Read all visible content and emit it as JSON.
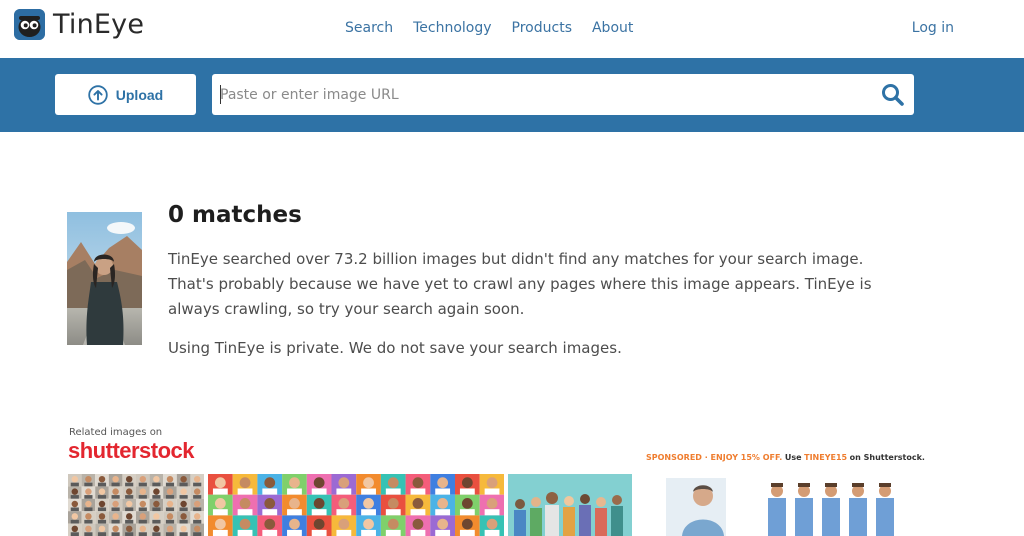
{
  "header": {
    "brand": "TinEye",
    "logo_icon": "tineye-logo-icon",
    "nav": [
      "Search",
      "Technology",
      "Products",
      "About"
    ],
    "login": "Log in"
  },
  "search": {
    "upload_label": "Upload",
    "upload_icon": "upload-arrow-icon",
    "placeholder": "Paste or enter image URL",
    "value": "",
    "search_icon": "magnifier-icon"
  },
  "result": {
    "title": "0 matches",
    "paragraph": "TinEye searched over 73.2 billion images but didn't find any matches for your search image. That's probably because we have yet to crawl any pages where this image appears. TinEye is always crawling, so try your search again soon.",
    "privacy": "Using TinEye is private. We do not save your search images."
  },
  "related": {
    "label": "Related images on",
    "provider_logo": "shutterstock",
    "sponsor_prefix": "SPONSORED · ENJOY 15% OFF.",
    "sponsor_use": "Use",
    "sponsor_code": "TINEYE15",
    "sponsor_suffix": "on Shutterstock."
  },
  "colors": {
    "band": "#2e72a6",
    "link": "#3b73a3",
    "shutterstock_red": "#e3262f",
    "sponsor_orange": "#ef7d2f"
  }
}
